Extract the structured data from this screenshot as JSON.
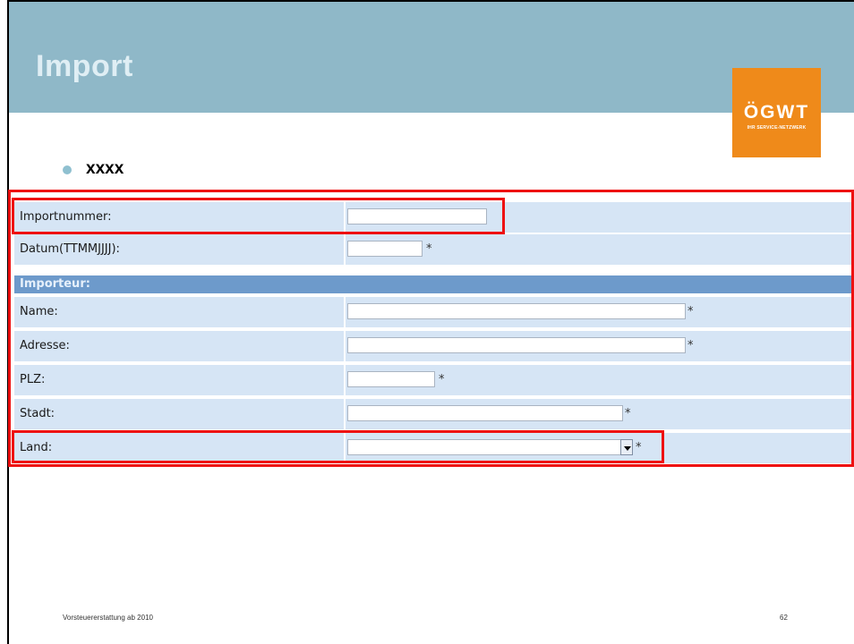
{
  "slide": {
    "title": "Import",
    "bullet": "xxxx",
    "logo": {
      "text": "ÖGWT",
      "subtitle": "IHR SERVICE-NETZWERK",
      "color": "#ef8a1a"
    },
    "footer": {
      "left": "Vorsteuererstattung ab 2010",
      "page_number": "62"
    }
  },
  "form": {
    "fields": [
      {
        "label": "Importnummer:",
        "value": "",
        "required": false
      },
      {
        "label": "Datum(TTMMJJJJ):",
        "value": "",
        "required": true
      }
    ],
    "section_label": "Importeur:",
    "importer_fields": [
      {
        "label": "Name:",
        "value": "",
        "required": true
      },
      {
        "label": "Adresse:",
        "value": "",
        "required": true
      },
      {
        "label": "PLZ:",
        "value": "",
        "required": true
      },
      {
        "label": "Stadt:",
        "value": "",
        "required": true
      },
      {
        "label": "Land:",
        "value": "",
        "required": true,
        "type": "select"
      }
    ],
    "required_marker": "*"
  },
  "colors": {
    "header": "#8fb8c8",
    "row_background": "#d6e5f5",
    "section_background": "#6d9acb",
    "highlight": "#ee1111"
  }
}
